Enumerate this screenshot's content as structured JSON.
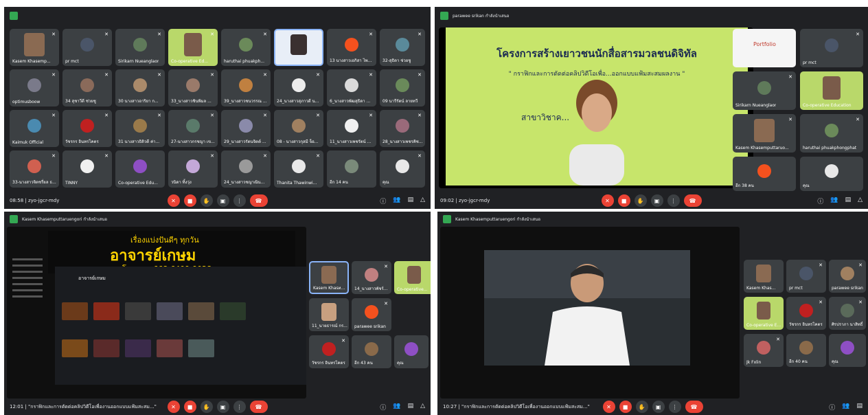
{
  "panel1": {
    "tiles": [
      {
        "name": "Kasem Khasemp..."
      },
      {
        "name": "pr mct"
      },
      {
        "name": "Sirikarn Nueanglaor"
      },
      {
        "name": "Co-operative Ed..."
      },
      {
        "name": "haruthai phuakph..."
      },
      {
        "name": ""
      },
      {
        "name": "13 นางสาวเอกิสา ไพ..."
      },
      {
        "name": "32-สุธิดา ช่วยชู"
      },
      {
        "name": "optimusboow"
      },
      {
        "name": "34 สุชาวีดี ช่วยชู"
      },
      {
        "name": "30 นางสาวอาริยา ก..."
      },
      {
        "name": "33_นางสาวชินพิมล ..."
      },
      {
        "name": "39_นางสาวชนวรรณ ..."
      },
      {
        "name": "24_นางสาวสุภาวดี น..."
      },
      {
        "name": "6_นางสาวพัฒสุธิดา ..."
      },
      {
        "name": "09 นารีรัตน์ ลายทวี"
      },
      {
        "name": "Kaimuk Official"
      },
      {
        "name": "วัชรกร อินทรโคตร"
      },
      {
        "name": "31 นางสาวธิติวดี ค่า..."
      },
      {
        "name": "27-นางสาวกรชญา เข..."
      },
      {
        "name": "29_นางสาวรัตนจิตต์ ..."
      },
      {
        "name": "08 - นางสาวกุสมี จ็อ..."
      },
      {
        "name": "11_นางสาวเพชรัตน์ ..."
      },
      {
        "name": "28_นางสาวเพชรคิช..."
      },
      {
        "name": "33-นางสาวจิตชรี่ยล ธ..."
      },
      {
        "name": "TINNY"
      },
      {
        "name": "Co-operative Edu..."
      },
      {
        "name": "วนิดา ทิ้งวุ่ง"
      },
      {
        "name": "24_นางสาวชญาณิน..."
      },
      {
        "name": "Thanita Thawinwi..."
      },
      {
        "name": "อีก 14 คน"
      },
      {
        "name": "คุณ"
      }
    ],
    "time": "08:58 | zyo-jgcr-mdy"
  },
  "panel2": {
    "presenter": "parawee srikan กำลังนำเสนอ",
    "slide_title": "โครงการสร้างเยาวชนนักสื่อสารมวลชนดิจิทัล",
    "slide_subtitle": "\" กราฟิกและการตัดต่อคลิปวิดีโอเพื่อ...ออกแบบแฟ้มสะสมผลงาน \"",
    "slide_line": "สาขาวิชาค...",
    "tiles": [
      {
        "name": "Portfolio"
      },
      {
        "name": "pr mct"
      },
      {
        "name": "Sirikarn Nueanglaor"
      },
      {
        "name": "Co-operative Education"
      },
      {
        "name": "Kasem Khasemputtaruo..."
      },
      {
        "name": "haruthai phuakphongphat"
      },
      {
        "name": "อีก 38 คน"
      },
      {
        "name": "คุณ"
      }
    ],
    "time": "09:02 | zyo-jgcr-mdy"
  },
  "panel3": {
    "presenter": "Kasem Khasemputtaruengori กำลังนำเสนอ",
    "banner_top": "เรื่องแบ่งปันดีๆ ทุกวัน",
    "banner_main": "อาจารย์เกษม",
    "banner_phone": "โทรมา +668-6409-9028",
    "channel": "อาจารย์เกษม",
    "tiles": [
      {
        "name": "Kasem Khasи..."
      },
      {
        "name": "14_นางสาวพัชร์ณ..."
      },
      {
        "name": "Co-operative..."
      },
      {
        "name": "11_นายธารณ์ กร..."
      },
      {
        "name": "parawee srikan"
      },
      {
        "name": "วัชรกร อินทรโคตร"
      },
      {
        "name": "อีก 43 คน"
      },
      {
        "name": "คุณ"
      }
    ],
    "time": "12:01 | \"กราฟิกและการตัดต่อคลิปวิดีโอเพื่องานออกแบบแฟ้มสะสม...\""
  },
  "panel4": {
    "presenter": "Kasem Khasemputtaruengori กำลังนำเสนอ",
    "tiles": [
      {
        "name": "Kasem Khas..."
      },
      {
        "name": "pr mct"
      },
      {
        "name": "parawee srikan"
      },
      {
        "name": "Co-operative Ed..."
      },
      {
        "name": "วัชรกร อินทรโคตร"
      },
      {
        "name": "ศิรปราภา นาสิทธิ์"
      },
      {
        "name": "Jk Fxlin"
      },
      {
        "name": "อีก 40 คน"
      },
      {
        "name": "คุณ"
      }
    ],
    "time": "10:27 | \"กราฟิกและการตัดต่อคลิปวิดีโอเพื่องานออกแบบแฟ้มสะสม...\""
  },
  "colors": {
    "bg": "#202124",
    "tile": "#3c4043",
    "end_call": "#ea4335",
    "slide": "#c7e56b",
    "accent": "#34a853"
  },
  "icons": [
    "mic-off-icon",
    "camera-off-icon",
    "raise-hand-icon",
    "present-icon",
    "more-options-icon",
    "end-call-icon",
    "info-icon",
    "people-icon",
    "chat-icon",
    "activities-icon"
  ]
}
